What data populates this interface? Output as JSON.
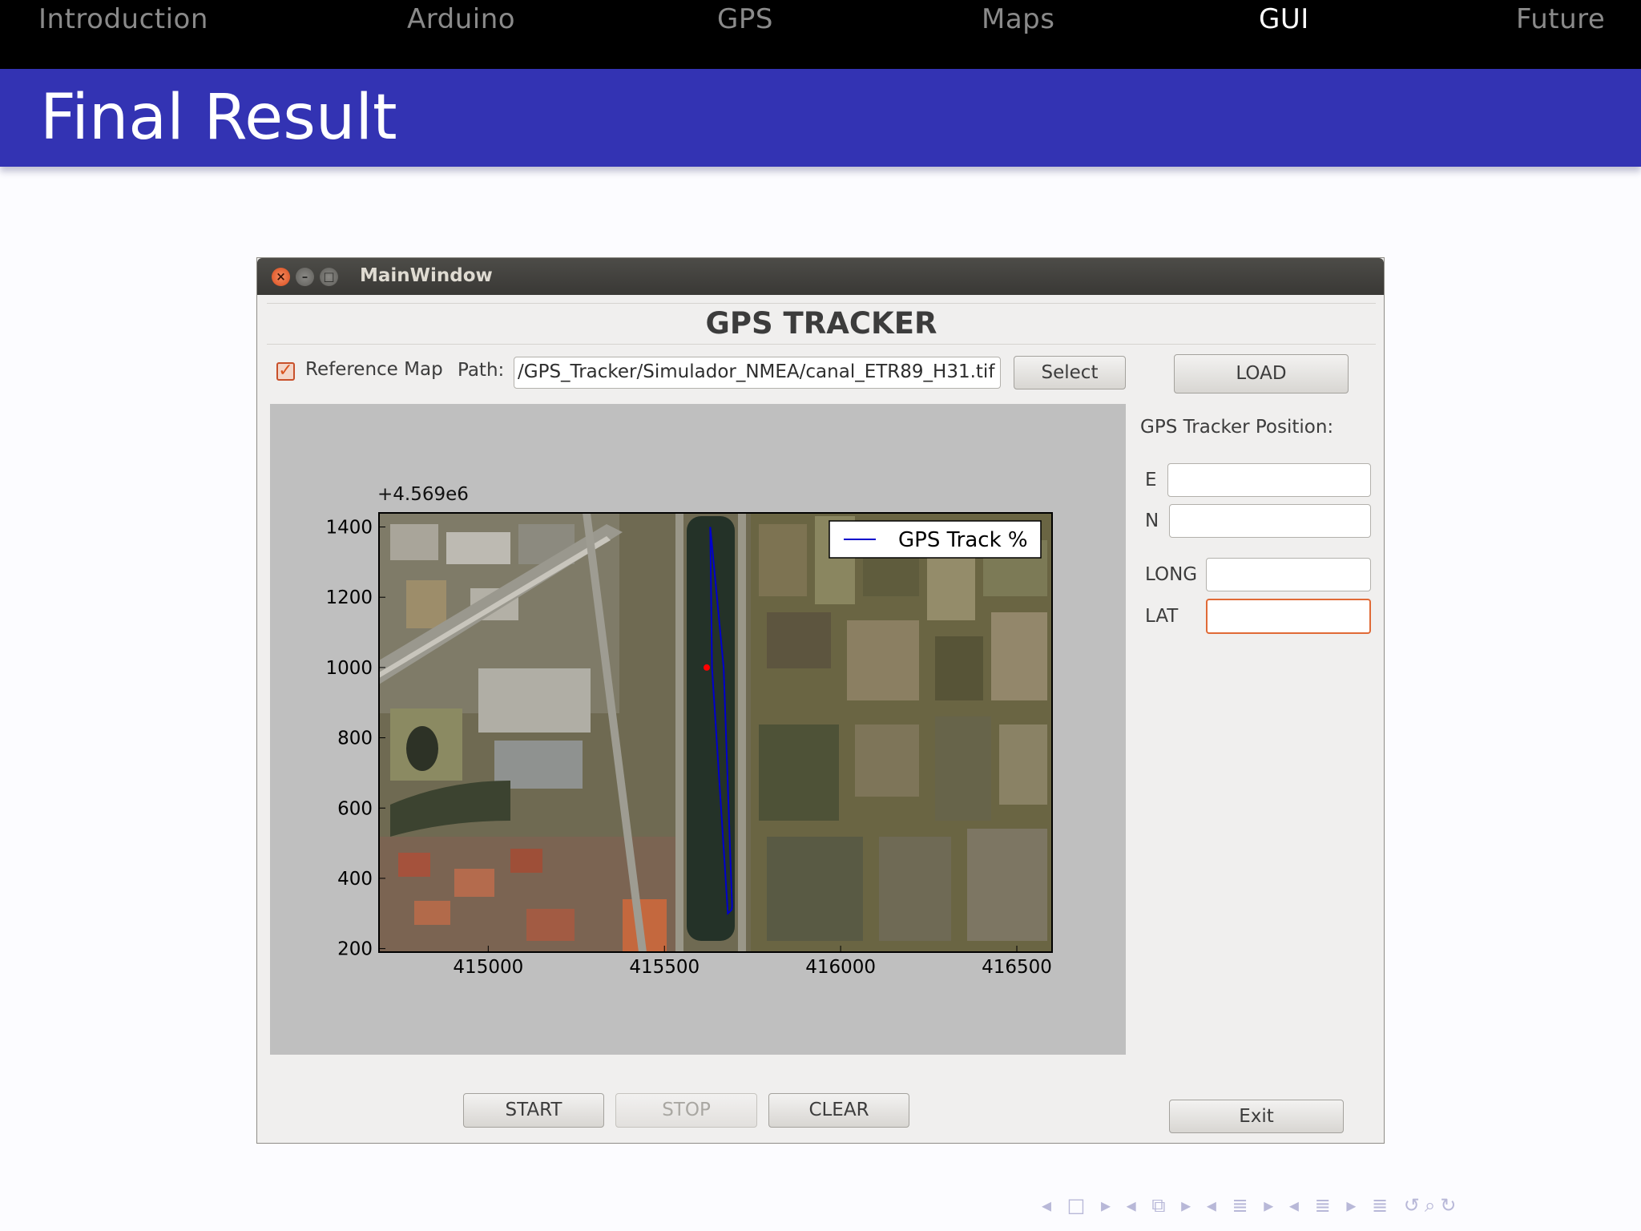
{
  "nav": {
    "items": [
      {
        "label": "Introduction",
        "active": false
      },
      {
        "label": "Arduino",
        "active": false
      },
      {
        "label": "GPS",
        "active": false
      },
      {
        "label": "Maps",
        "active": false
      },
      {
        "label": "GUI",
        "active": true
      },
      {
        "label": "Future",
        "active": false
      }
    ]
  },
  "frame": {
    "title": "Final Result"
  },
  "window": {
    "title": "MainWindow",
    "header": "GPS TRACKER",
    "reference_map": {
      "label": "Reference Map",
      "checked": true
    },
    "path": {
      "label": "Path:",
      "value": "/GPS_Tracker/Simulador_NMEA/canal_ETR89_H31.tif"
    },
    "select_label": "Select",
    "load_label": "LOAD",
    "position": {
      "title": "GPS Tracker Position:",
      "e_label": "E",
      "n_label": "N",
      "long_label": "LONG",
      "lat_label": "LAT",
      "e_value": "",
      "n_value": "",
      "long_value": "",
      "lat_value": ""
    },
    "start_label": "START",
    "stop_label": "STOP",
    "clear_label": "CLEAR",
    "exit_label": "Exit"
  },
  "chart_data": {
    "type": "line",
    "title": "",
    "xlabel": "",
    "ylabel": "",
    "y_offset_label": "+4.569e6",
    "xlim": [
      414690,
      416600
    ],
    "ylim": [
      190,
      1440
    ],
    "xticks": [
      415000,
      415500,
      416000,
      416500
    ],
    "yticks": [
      200,
      400,
      600,
      800,
      1000,
      1200,
      1400
    ],
    "legend": {
      "position": "top-right",
      "entries": [
        "GPS Track %"
      ]
    },
    "series": [
      {
        "name": "GPS Track %",
        "color": "#0000cc",
        "x": [
          415630,
          415635,
          415680,
          415690,
          415692,
          415668,
          415630
        ],
        "y": [
          1400,
          1000,
          300,
          310,
          320,
          1000,
          1400
        ]
      }
    ],
    "current_position": {
      "x": 415620,
      "y": 1000,
      "color": "#ff0000"
    }
  },
  "beamer_nav_icons": [
    "nav-prev-frame-icon",
    "nav-frame-icon",
    "nav-prev-subsection-icon",
    "nav-section-icon",
    "nav-doc-icon",
    "nav-search-icon",
    "nav-back-icon"
  ]
}
